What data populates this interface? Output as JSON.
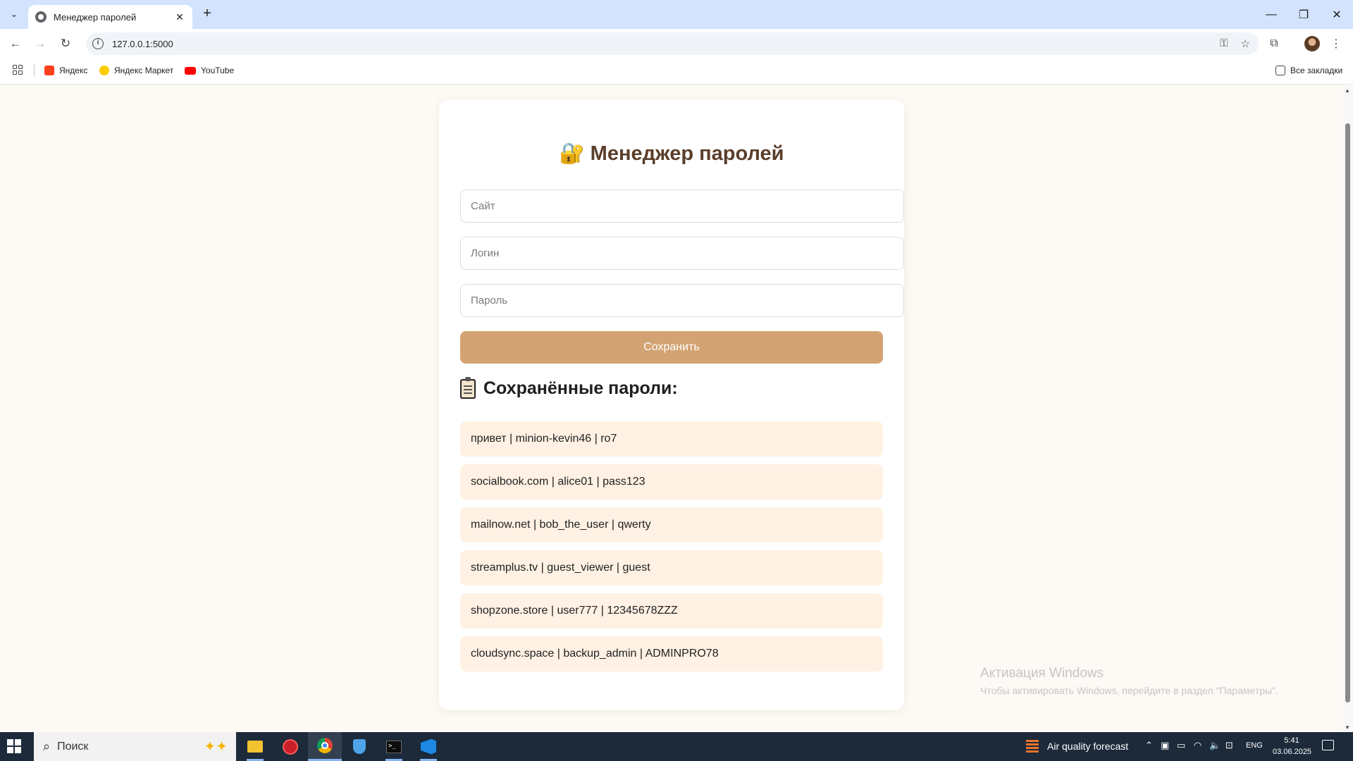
{
  "browser": {
    "tab_title": "Менеджер паролей",
    "url": "127.0.0.1:5000",
    "bookmarks": [
      {
        "label": "Яндекс",
        "color": "#fc3f1d"
      },
      {
        "label": "Яндекс Маркет",
        "color": "#ffcc00"
      },
      {
        "label": "YouTube",
        "color": "#ff0000"
      }
    ],
    "all_bookmarks_label": "Все закладки"
  },
  "page": {
    "title": "Менеджер паролей",
    "title_emoji": "🔐",
    "site_placeholder": "Сайт",
    "login_placeholder": "Логин",
    "password_placeholder": "Пароль",
    "save_label": "Сохранить",
    "saved_title": "Сохранённые пароли:",
    "entries": [
      "привет | minion-kevin46 | ro7",
      "socialbook.com | alice01 | pass123",
      "mailnow.net | bob_the_user | qwerty",
      "streamplus.tv | guest_viewer | guest",
      "shopzone.store | user777 | 12345678ZZZ",
      "cloudsync.space | backup_admin | ADMINPRO78"
    ],
    "accent_color": "#d4a373",
    "entry_bg": "#fff1e3"
  },
  "watermark": {
    "title": "Активация Windows",
    "subtitle": "Чтобы активировать Windows, перейдите в раздел \"Параметры\"."
  },
  "taskbar": {
    "search_label": "Поиск",
    "weather_label": "Air quality forecast",
    "language": "ENG",
    "time": "5:41",
    "date": "03.06.2025"
  }
}
